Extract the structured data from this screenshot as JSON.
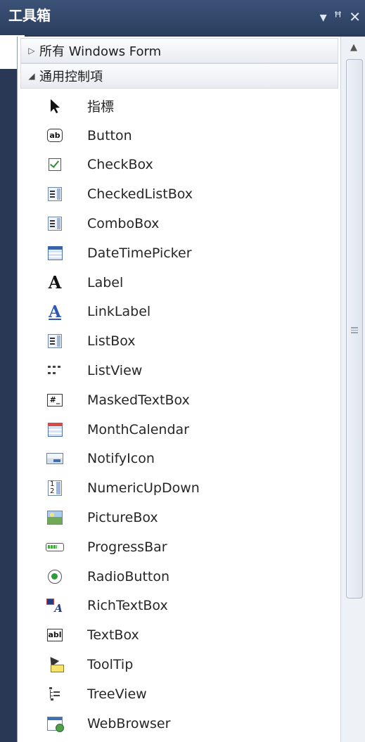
{
  "window": {
    "title": "工具箱",
    "controls": {
      "dropdown": "▾",
      "pin": "ꟸ",
      "close": "✕"
    }
  },
  "sections": [
    {
      "label": "所有 Windows Form",
      "expanded": false
    },
    {
      "label": "通用控制項",
      "expanded": true
    }
  ],
  "items": [
    {
      "label": "指標",
      "icon": "pointer-icon"
    },
    {
      "label": "Button",
      "icon": "button-icon"
    },
    {
      "label": "CheckBox",
      "icon": "checkbox-icon"
    },
    {
      "label": "CheckedListBox",
      "icon": "checkedlistbox-icon"
    },
    {
      "label": "ComboBox",
      "icon": "combobox-icon"
    },
    {
      "label": "DateTimePicker",
      "icon": "datetimepicker-icon"
    },
    {
      "label": "Label",
      "icon": "label-icon"
    },
    {
      "label": "LinkLabel",
      "icon": "linklabel-icon"
    },
    {
      "label": "ListBox",
      "icon": "listbox-icon"
    },
    {
      "label": "ListView",
      "icon": "listview-icon"
    },
    {
      "label": "MaskedTextBox",
      "icon": "maskedtextbox-icon"
    },
    {
      "label": "MonthCalendar",
      "icon": "monthcalendar-icon"
    },
    {
      "label": "NotifyIcon",
      "icon": "notifyicon-icon"
    },
    {
      "label": "NumericUpDown",
      "icon": "numericupdown-icon"
    },
    {
      "label": "PictureBox",
      "icon": "picturebox-icon"
    },
    {
      "label": "ProgressBar",
      "icon": "progressbar-icon"
    },
    {
      "label": "RadioButton",
      "icon": "radiobutton-icon"
    },
    {
      "label": "RichTextBox",
      "icon": "richtextbox-icon"
    },
    {
      "label": "TextBox",
      "icon": "textbox-icon"
    },
    {
      "label": "ToolTip",
      "icon": "tooltip-icon"
    },
    {
      "label": "TreeView",
      "icon": "treeview-icon"
    },
    {
      "label": "WebBrowser",
      "icon": "webbrowser-icon"
    }
  ],
  "icon_text": {
    "button": "ab",
    "label": "A",
    "linklabel": "A",
    "masked": "#_",
    "textbox": "abl",
    "numeric": "1\n2"
  },
  "colors": {
    "titlebar": "#2b3e60",
    "panel_frame": "#293955",
    "accent_green": "#2f8f2f",
    "link_blue": "#2c59b5"
  }
}
